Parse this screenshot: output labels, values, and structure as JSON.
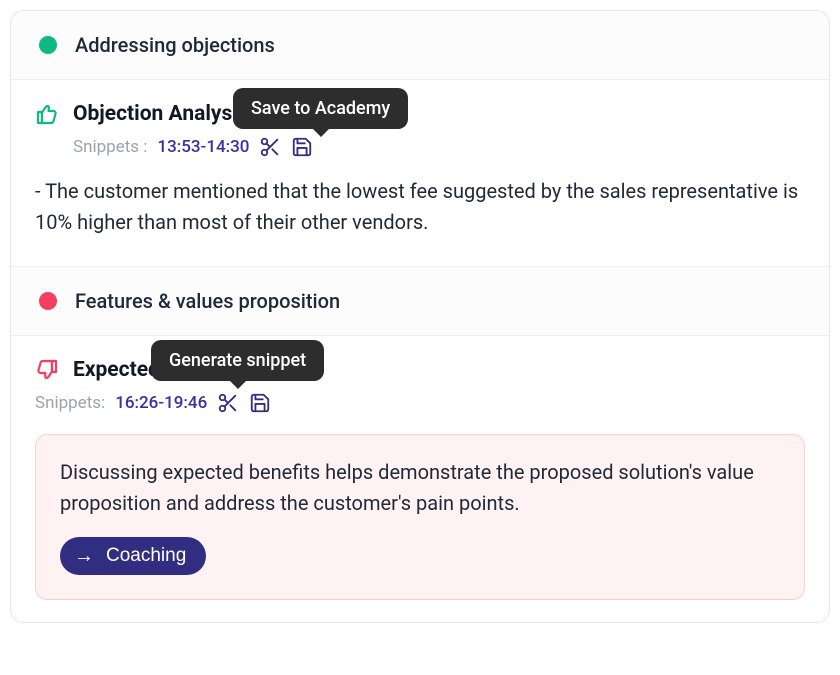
{
  "sections": {
    "s1": {
      "header": "Addressing objections",
      "block": {
        "title": "Objection Analysis",
        "snippets_prefix": "Snippets :",
        "time": "13:53-14:30",
        "body": "- The customer mentioned that the lowest fee suggested by the sales representative is 10% higher than most of their other vendors."
      }
    },
    "s2": {
      "header": "Features & values proposition",
      "block": {
        "title": "Expected Benefits",
        "snippets_prefix": "Snippets:",
        "time": "16:26-19:46",
        "callout": "Discussing expected benefits helps demonstrate the proposed solution's value proposition and address the customer's pain points.",
        "coach_label": "Coaching"
      }
    }
  },
  "tooltips": {
    "save": "Save to Academy",
    "generate": "Generate snippet"
  }
}
